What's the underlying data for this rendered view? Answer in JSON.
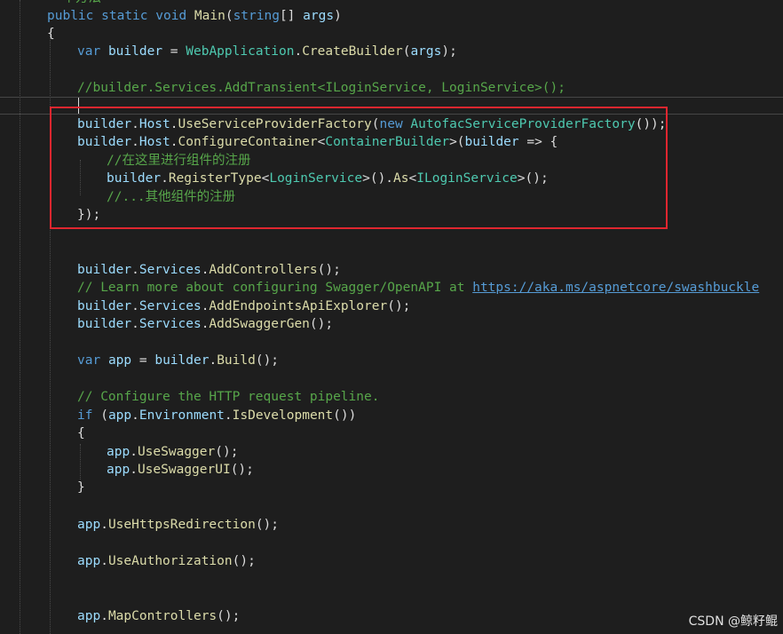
{
  "partial_line": "  个方法",
  "code": {
    "main_sig": {
      "public": "public",
      "static": "static",
      "void": "void",
      "name": "Main",
      "paren_open": "(",
      "string": "string",
      "arr": "[] ",
      "args": "args",
      "paren_close": ")"
    },
    "brace_open": "{",
    "builder_decl": {
      "var": "var",
      "builder": "builder",
      "eq": " = ",
      "type": "WebApplication",
      "dot": ".",
      "method": "CreateBuilder",
      "open": "(",
      "arg": "args",
      "close": ");"
    },
    "comment_transient": "//builder.Services.AddTransient<ILoginService, LoginService>();",
    "host_factory": {
      "builder": "builder",
      "dot1": ".",
      "host": "Host",
      "dot2": ".",
      "method": "UseServiceProviderFactory",
      "open": "(",
      "new": "new",
      "space": " ",
      "type": "AutofacServiceProviderFactory",
      "close": "());"
    },
    "configure": {
      "builder": "builder",
      "dot1": ".",
      "host": "Host",
      "dot2": ".",
      "method": "ConfigureContainer",
      "lt": "<",
      "type": "ContainerBuilder",
      "gt": ">",
      "open": "(",
      "param": "builder",
      "arrow": " => {"
    },
    "comment_register": "//在这里进行组件的注册",
    "register": {
      "builder": "builder",
      "dot": ".",
      "method": "RegisterType",
      "lt": "<",
      "type": "LoginService",
      "gt": ">",
      "mid": "().",
      "as": "As",
      "lt2": "<",
      "iface": "ILoginService",
      "gt2": ">",
      "end": "();"
    },
    "comment_others": "//...其他组件的注册",
    "close_lambda": "});",
    "add_controllers": {
      "builder": "builder",
      "dot1": ".",
      "services": "Services",
      "dot2": ".",
      "method": "AddControllers",
      "end": "();"
    },
    "comment_swagger": "// Learn more about configuring Swagger/OpenAPI at ",
    "swagger_link": "https://aka.ms/aspnetcore/swashbuckle",
    "add_explorer": {
      "builder": "builder",
      "dot1": ".",
      "services": "Services",
      "dot2": ".",
      "method": "AddEndpointsApiExplorer",
      "end": "();"
    },
    "add_swaggergen": {
      "builder": "builder",
      "dot1": ".",
      "services": "Services",
      "dot2": ".",
      "method": "AddSwaggerGen",
      "end": "();"
    },
    "app_build": {
      "var": "var",
      "app": "app",
      "eq": " = ",
      "builder": "builder",
      "dot": ".",
      "method": "Build",
      "end": "();"
    },
    "comment_pipeline": "// Configure the HTTP request pipeline.",
    "if_dev": {
      "if": "if",
      "open": " (",
      "app": "app",
      "dot1": ".",
      "env": "Environment",
      "dot2": ".",
      "method": "IsDevelopment",
      "end": "())"
    },
    "brace_open2": "{",
    "use_swagger": {
      "app": "app",
      "dot": ".",
      "method": "UseSwagger",
      "end": "();"
    },
    "use_swaggerui": {
      "app": "app",
      "dot": ".",
      "method": "UseSwaggerUI",
      "end": "();"
    },
    "brace_close2": "}",
    "use_https": {
      "app": "app",
      "dot": ".",
      "method": "UseHttpsRedirection",
      "end": "();"
    },
    "use_auth": {
      "app": "app",
      "dot": ".",
      "method": "UseAuthorization",
      "end": "();"
    },
    "map_controllers": {
      "app": "app",
      "dot": ".",
      "method": "MapControllers",
      "end": "();"
    }
  },
  "watermark": "CSDN @鲸籽鲲",
  "colors": {
    "background": "#1e1e1e",
    "keyword": "#569cd6",
    "type": "#4ec9b0",
    "method": "#dcdcaa",
    "identifier": "#9cdcfe",
    "comment": "#57a64a",
    "highlight_box": "#e0262f"
  }
}
